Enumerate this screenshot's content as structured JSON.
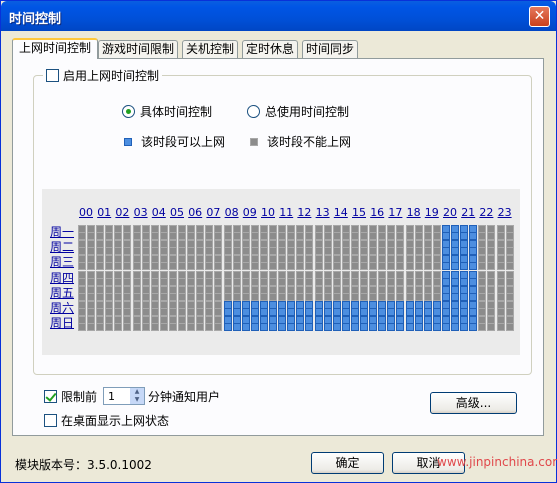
{
  "window": {
    "title": "时间控制",
    "close_symbol": "✕"
  },
  "tabs": [
    {
      "label": "上网时间控制",
      "active": true
    },
    {
      "label": "游戏时间限制",
      "active": false
    },
    {
      "label": "关机控制",
      "active": false
    },
    {
      "label": "定时休息",
      "active": false
    },
    {
      "label": "时间同步",
      "active": false
    }
  ],
  "group": {
    "enable_label": "启用上网时间控制",
    "enable_checked": false,
    "mode_specific_label": "具体时间控制",
    "mode_specific_checked": true,
    "mode_total_label": "总使用时间控制",
    "mode_total_checked": false,
    "legend_allowed_label": "该时段可以上网",
    "legend_blocked_label": "该时段不能上网"
  },
  "colors": {
    "allowed": "#4c8ee0",
    "blocked": "#8c8c8c"
  },
  "schedule": {
    "hours": [
      "00",
      "01",
      "02",
      "03",
      "04",
      "05",
      "06",
      "07",
      "08",
      "09",
      "10",
      "11",
      "12",
      "13",
      "14",
      "15",
      "16",
      "17",
      "18",
      "19",
      "20",
      "21",
      "22",
      "23"
    ],
    "days": [
      "周一",
      "周二",
      "周三",
      "周四",
      "周五",
      "周六",
      "周日"
    ],
    "allowed": {
      "周一": [
        20,
        21
      ],
      "周二": [
        20,
        21
      ],
      "周三": [
        20,
        21
      ],
      "周四": [
        20,
        21
      ],
      "周五": [
        20,
        21
      ],
      "周六": [
        8,
        9,
        10,
        11,
        12,
        13,
        14,
        15,
        16,
        17,
        18,
        19,
        20,
        21
      ],
      "周日": [
        8,
        9,
        10,
        11,
        12,
        13,
        14,
        15,
        16,
        17,
        18,
        19,
        20,
        21
      ]
    }
  },
  "notify": {
    "checkbox_label": "限制前",
    "checked": true,
    "value": "1",
    "suffix_label": "分钟通知用户"
  },
  "desktop_status": {
    "label": "在桌面显示上网状态",
    "checked": false
  },
  "advanced_button": "高级...",
  "footer": {
    "version_text": "模块版本号：3.5.0.1002",
    "ok_button": "确定",
    "cancel_button": "取消",
    "watermark": "www.jinpinchina.com"
  }
}
